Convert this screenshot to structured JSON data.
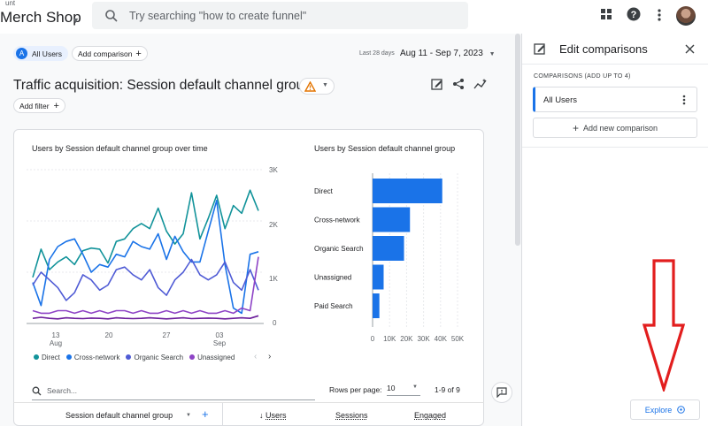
{
  "header": {
    "account_fragment": "unt",
    "property_name": "Merch Shop",
    "search_placeholder": "Try searching \"how to create funnel\""
  },
  "toolbar": {
    "segment_badge": "A",
    "segment_label": "All Users",
    "add_comparison_label": "Add comparison",
    "date_prefix": "Last 28 days",
    "date_range": "Aug 11 - Sep 7, 2023"
  },
  "report": {
    "title": "Traffic acquisition: Session default channel group",
    "add_filter_label": "Add filter"
  },
  "line_chart": {
    "title": "Users by Session default channel group over time",
    "y_ticks": [
      "3K",
      "2K",
      "1K",
      "0"
    ],
    "x_ticks": [
      {
        "day": "13",
        "month": "Aug"
      },
      {
        "day": "20",
        "month": ""
      },
      {
        "day": "27",
        "month": ""
      },
      {
        "day": "03",
        "month": "Sep"
      }
    ],
    "legend": [
      "Direct",
      "Cross-network",
      "Organic Search",
      "Unassigned"
    ]
  },
  "bar_chart": {
    "title": "Users by Session default channel group",
    "x_ticks": [
      "0",
      "10K",
      "20K",
      "30K",
      "40K",
      "50K"
    ]
  },
  "chart_data": [
    {
      "type": "line",
      "title": "Users by Session default channel group over time",
      "x": [
        "Aug 11",
        "Aug 12",
        "Aug 13",
        "Aug 14",
        "Aug 15",
        "Aug 16",
        "Aug 17",
        "Aug 18",
        "Aug 19",
        "Aug 20",
        "Aug 21",
        "Aug 22",
        "Aug 23",
        "Aug 24",
        "Aug 25",
        "Aug 26",
        "Aug 27",
        "Aug 28",
        "Aug 29",
        "Aug 30",
        "Aug 31",
        "Sep 1",
        "Sep 2",
        "Sep 3",
        "Sep 4",
        "Sep 5",
        "Sep 6",
        "Sep 7"
      ],
      "ylim": [
        0,
        3000
      ],
      "series": [
        {
          "name": "Direct",
          "color": "#12939a",
          "values": [
            900,
            1450,
            1050,
            1200,
            1300,
            1150,
            1420,
            1470,
            1450,
            1180,
            1600,
            1650,
            1850,
            1950,
            1850,
            2250,
            1800,
            1550,
            1750,
            2550,
            1650,
            2050,
            2500,
            1850,
            2300,
            2150,
            2600,
            2200
          ]
        },
        {
          "name": "Cross-network",
          "color": "#1a73e8",
          "values": [
            800,
            350,
            1250,
            1500,
            1600,
            1650,
            1350,
            1000,
            1150,
            1100,
            1350,
            1300,
            1600,
            1500,
            1450,
            1750,
            1250,
            1700,
            1400,
            1200,
            1200,
            1800,
            2400,
            1150,
            300,
            200,
            1350,
            1400
          ]
        },
        {
          "name": "Organic Search",
          "color": "#4f5bd5",
          "values": [
            750,
            1000,
            850,
            700,
            450,
            600,
            950,
            850,
            650,
            750,
            1050,
            1100,
            950,
            850,
            1050,
            700,
            550,
            850,
            1000,
            1250,
            950,
            850,
            950,
            1200,
            800,
            650,
            1050,
            650
          ]
        },
        {
          "name": "Unassigned",
          "color": "#8e44c6",
          "values": [
            250,
            200,
            200,
            250,
            250,
            200,
            250,
            200,
            250,
            200,
            250,
            250,
            200,
            250,
            200,
            200,
            250,
            200,
            250,
            200,
            250,
            200,
            200,
            250,
            200,
            300,
            250,
            1300
          ]
        },
        {
          "name": "Paid Search",
          "color": "#6a1b9a",
          "values": [
            100,
            120,
            100,
            90,
            110,
            100,
            95,
            105,
            100,
            90,
            110,
            100,
            95,
            100,
            110,
            100,
            90,
            100,
            110,
            95,
            100,
            105,
            100,
            90,
            100,
            110,
            100,
            150
          ]
        }
      ]
    },
    {
      "type": "bar",
      "title": "Users by Session default channel group",
      "categories": [
        "Direct",
        "Cross-network",
        "Organic Search",
        "Unassigned",
        "Paid Search"
      ],
      "values": [
        41000,
        22000,
        18500,
        6500,
        4000
      ],
      "xlim": [
        0,
        50000
      ]
    }
  ],
  "table": {
    "search_placeholder": "Search...",
    "rows_per_page_label": "Rows per page:",
    "rows_per_page_value": "10",
    "pagination": "1-9 of 9",
    "columns": [
      "Session default channel group",
      "Users",
      "Sessions",
      "Engaged"
    ]
  },
  "side_panel": {
    "title": "Edit comparisons",
    "section_label": "COMPARISONS (ADD UP TO 4)",
    "comparison_item": "All Users",
    "add_new_label": "Add new comparison",
    "explore_label": "Explore"
  },
  "colors": {
    "accent": "#1a73e8",
    "warning": "#e37400",
    "annotation_arrow": "#e21e1e"
  }
}
